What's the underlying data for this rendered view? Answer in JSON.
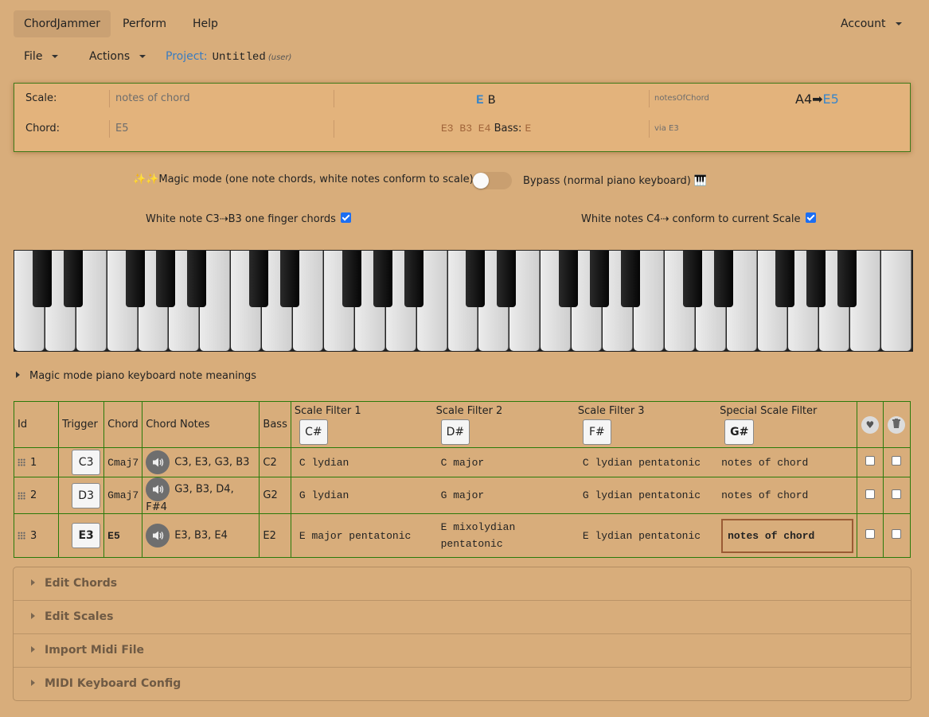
{
  "nav": {
    "items": [
      {
        "label": "ChordJammer",
        "active": true
      },
      {
        "label": "Perform",
        "active": false
      },
      {
        "label": "Help",
        "active": false
      }
    ],
    "account_label": "Account"
  },
  "subnav": {
    "file_label": "File",
    "actions_label": "Actions",
    "project_label": "Project:",
    "project_name": "Untitled",
    "project_type": "(user)"
  },
  "status": {
    "scale_label": "Scale:",
    "scale_value": "notes of chord",
    "scale_notes_highlight": "E",
    "scale_notes_rest": "B",
    "scale_id": "notesOfChord",
    "range_from": "A4",
    "range_arrow": "➡",
    "range_to": "E5",
    "chord_label": "Chord:",
    "chord_value": "E5",
    "chord_notes": "E3 B3 E4",
    "bass_label": "Bass:",
    "bass_value": "E",
    "via": "via E3"
  },
  "options": {
    "magic_icon": "✨✨",
    "magic_label": "Magic mode (one note chords, white notes conform to scale)",
    "bypass_on": false,
    "bypass_label": "Bypass (normal piano keyboard) 🎹",
    "one_finger_label": "White note C3⇢B3 one finger chords",
    "one_finger_checked": true,
    "conform_label": "White notes C4⇢ conform to current Scale",
    "conform_checked": true
  },
  "keyboard": {
    "white_keys": 29,
    "start_note": "C"
  },
  "meanings_label": "Magic mode piano keyboard note meanings",
  "table": {
    "headers": {
      "id": "Id",
      "trigger": "Trigger",
      "chord": "Chord",
      "chord_notes": "Chord Notes",
      "bass": "Bass",
      "sf1": "Scale Filter 1",
      "sf1_key": "C#",
      "sf2": "Scale Filter 2",
      "sf2_key": "D#",
      "sf3": "Scale Filter 3",
      "sf3_key": "F#",
      "special": "Special Scale Filter",
      "special_key": "G#",
      "favorite_icon": "♥",
      "delete_icon": "🗑"
    },
    "rows": [
      {
        "id": "1",
        "trigger": "C3",
        "chord": "Cmaj7",
        "notes": "C3, E3, G3, B3",
        "bass": "C2",
        "sf1": "C lydian",
        "sf2": "C major",
        "sf3": "C lydian pentatonic",
        "special": "notes of chord",
        "active": false
      },
      {
        "id": "2",
        "trigger": "D3",
        "chord": "Gmaj7",
        "notes": "G3, B3, D4, F#4",
        "bass": "G2",
        "sf1": "G lydian",
        "sf2": "G major",
        "sf3": "G lydian pentatonic",
        "special": "notes of chord",
        "active": false
      },
      {
        "id": "3",
        "trigger": "E3",
        "chord": "E5",
        "notes": "E3, B3, E4",
        "bass": "E2",
        "sf1": "E major pentatonic",
        "sf2": "E mixolydian pentatonic",
        "sf3": "E lydian pentatonic",
        "special": "notes of chord",
        "active": true
      }
    ]
  },
  "accordion": [
    {
      "label": "Edit Chords"
    },
    {
      "label": "Edit Scales"
    },
    {
      "label": "Import Midi File"
    },
    {
      "label": "MIDI Keyboard Config"
    }
  ]
}
